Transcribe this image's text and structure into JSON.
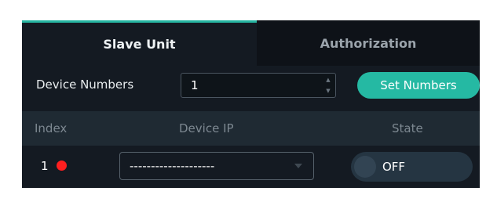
{
  "tabs": [
    {
      "label": "Slave Unit",
      "active": true
    },
    {
      "label": "Authorization",
      "active": false
    }
  ],
  "device_numbers": {
    "label": "Device Numbers",
    "value": "1",
    "button_label": "Set Numbers"
  },
  "table": {
    "columns": [
      "Index",
      "Device IP",
      "State"
    ],
    "rows": [
      {
        "index": "1",
        "status_color": "#ff1f1f",
        "device_ip": "--------------------",
        "state": "OFF"
      }
    ]
  },
  "colors": {
    "accent": "#25b9a3",
    "panel_bg": "#141a22",
    "status_offline": "#ff1f1f"
  }
}
